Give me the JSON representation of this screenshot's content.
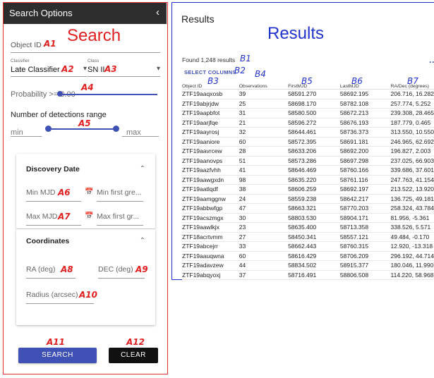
{
  "search_panel": {
    "title": "Search Options",
    "collapse_icon": "chevron-left-icon",
    "annotation_title": "Search",
    "object_id_label": "Object ID",
    "classifier_caption": "Classifier",
    "classifier_value": "Late Classifier",
    "class_caption": "Class",
    "class_value": "SN II",
    "probability_label": "Probability >= 0.00",
    "detections_label": "Number of detections range",
    "min_placeholder": "min",
    "max_placeholder": "max",
    "discovery": {
      "title": "Discovery Date",
      "min_mjd_label": "Min MJD",
      "min_first_placeholder": "Min first gre...",
      "max_mjd_label": "Max MJD",
      "max_first_placeholder": "Max first gr..."
    },
    "coordinates": {
      "title": "Coordinates",
      "ra_label": "RA (deg)",
      "dec_label": "DEC (deg)",
      "radius_label": "Radius (arcsec)"
    },
    "search_button": "SEARCH",
    "clear_button": "CLEAR"
  },
  "annotations": {
    "A1": "A1",
    "A2": "A2",
    "A3": "A3",
    "A4": "A4",
    "A5": "A5",
    "A6": "A6",
    "A7": "A7",
    "A8": "A8",
    "A9": "A9",
    "A10": "A10",
    "A11": "A11",
    "A12": "A12",
    "B1": "B1",
    "B2": "B2",
    "B3": "B3",
    "B4": "B4",
    "B5": "B5",
    "B6": "B6",
    "B7": "B7"
  },
  "results_panel": {
    "title": "Results",
    "annotation_title": "Results",
    "found_text": "Found 1,248 results",
    "select_columns": "SELECT COLUMNS",
    "more_icon": "more-horizontal-icon",
    "columns": [
      "Object ID",
      "Observations",
      "FirstMJD",
      "LastMJD",
      "RA/Dec (degrees)"
    ],
    "rows": [
      [
        "ZTF19aaqxosb",
        "39",
        "58591.270",
        "58692.195",
        "206.716, 16.282"
      ],
      [
        "ZTF19abjrjdw",
        "25",
        "58698.170",
        "58782.108",
        "257.774, 5.252"
      ],
      [
        "ZTF19aapbfot",
        "31",
        "58580.500",
        "58672.213",
        "239.308, 28.465"
      ],
      [
        "ZTF19aarjfqe",
        "21",
        "58596.272",
        "58676.193",
        "187.779, 0.465"
      ],
      [
        "ZTF19aayrosj",
        "32",
        "58644.461",
        "58736.373",
        "313.550, 10.550"
      ],
      [
        "ZTF19aaniore",
        "60",
        "58572.395",
        "58691.181",
        "246.965, 62.692"
      ],
      [
        "ZTF19aavrcew",
        "28",
        "58633.206",
        "58692.200",
        "196.827, 2.003"
      ],
      [
        "ZTF19aanovps",
        "51",
        "58573.286",
        "58697.298",
        "237.025, 66.903"
      ],
      [
        "ZTF19aazfvhh",
        "41",
        "58646.469",
        "58760.166",
        "339.686, 37.601"
      ],
      [
        "ZTF19aawgxdn",
        "98",
        "58635.220",
        "58761.116",
        "247.763, 41.154"
      ],
      [
        "ZTF19aatlqdf",
        "38",
        "58606.259",
        "58692.197",
        "213.522, 13.920"
      ],
      [
        "ZTF19aamggnw",
        "24",
        "58559.238",
        "58642.217",
        "136.725, 49.181"
      ],
      [
        "ZTF19abbwfgp",
        "47",
        "58663.321",
        "58770.203",
        "258.324, 43.784"
      ],
      [
        "ZTF19acszmgx",
        "30",
        "58803.530",
        "58904.171",
        "81.956, -5.361"
      ],
      [
        "ZTF19aawlkjx",
        "23",
        "58635.400",
        "58713.358",
        "338.526, 5.571"
      ],
      [
        "ZTF18acrtvmm",
        "27",
        "58450.341",
        "58557.121",
        "49.484, -0.170"
      ],
      [
        "ZTF19abcejrr",
        "33",
        "58662.443",
        "58760.315",
        "12.920, -13.318"
      ],
      [
        "ZTF19aauqwna",
        "60",
        "58616.429",
        "58706.209",
        "296.192, 44.714"
      ],
      [
        "ZTF19adavzew",
        "44",
        "58834.502",
        "58915.377",
        "180.046, 11.990"
      ],
      [
        "ZTF19abqyoxj",
        "37",
        "58716.491",
        "58806.508",
        "114.220, 58.968"
      ]
    ]
  }
}
